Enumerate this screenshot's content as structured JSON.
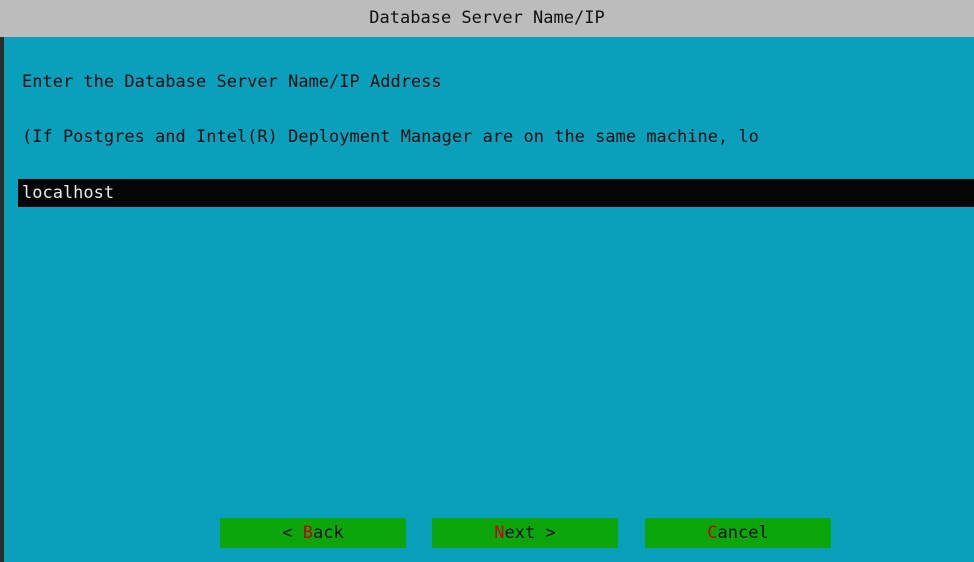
{
  "window": {
    "title": "Database Server Name/IP"
  },
  "dialog": {
    "prompt": "Enter the Database Server Name/IP Address",
    "hint": "(If Postgres and Intel(R) Deployment Manager are on the same machine, lo",
    "input_value": "localhost"
  },
  "buttons": {
    "back": {
      "prefix": "< ",
      "hotkey": "B",
      "rest": "ack"
    },
    "next": {
      "prefix": "",
      "hotkey": "N",
      "rest": "ext >"
    },
    "cancel": {
      "prefix": "",
      "hotkey": "C",
      "rest": "ancel"
    }
  },
  "colors": {
    "background": "#0aa0bc",
    "titlebar": "#bcbcbc",
    "input_background": "#050505",
    "button": "#0ca60c",
    "hotkey": "#c80000"
  }
}
